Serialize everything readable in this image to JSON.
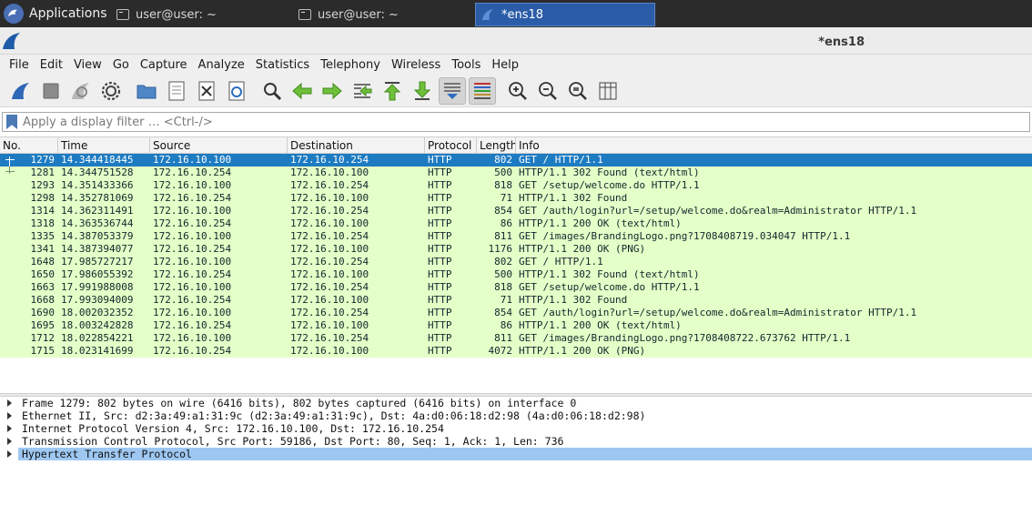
{
  "taskbar": {
    "apps_label": "Applications",
    "tasks": [
      {
        "label": "user@user: ~"
      },
      {
        "label": "user@user: ~"
      },
      {
        "label": "*ens18"
      }
    ]
  },
  "window": {
    "title": "*ens18"
  },
  "menu": [
    "File",
    "Edit",
    "View",
    "Go",
    "Capture",
    "Analyze",
    "Statistics",
    "Telephony",
    "Wireless",
    "Tools",
    "Help"
  ],
  "filter": {
    "placeholder": "Apply a display filter … <Ctrl-/>",
    "value": ""
  },
  "columns": {
    "no": "No.",
    "time": "Time",
    "source": "Source",
    "destination": "Destination",
    "protocol": "Protocol",
    "length": "Length",
    "info": "Info"
  },
  "packets": [
    {
      "no": "1279",
      "time": "14.344418445",
      "src": "172.16.10.100",
      "dst": "172.16.10.254",
      "proto": "HTTP",
      "len": "802",
      "info": "GET / HTTP/1.1"
    },
    {
      "no": "1281",
      "time": "14.344751528",
      "src": "172.16.10.254",
      "dst": "172.16.10.100",
      "proto": "HTTP",
      "len": "500",
      "info": "HTTP/1.1 302 Found  (text/html)"
    },
    {
      "no": "1293",
      "time": "14.351433366",
      "src": "172.16.10.100",
      "dst": "172.16.10.254",
      "proto": "HTTP",
      "len": "818",
      "info": "GET /setup/welcome.do HTTP/1.1"
    },
    {
      "no": "1298",
      "time": "14.352781069",
      "src": "172.16.10.254",
      "dst": "172.16.10.100",
      "proto": "HTTP",
      "len": "71",
      "info": "HTTP/1.1 302 Found"
    },
    {
      "no": "1314",
      "time": "14.362311491",
      "src": "172.16.10.100",
      "dst": "172.16.10.254",
      "proto": "HTTP",
      "len": "854",
      "info": "GET /auth/login?url=/setup/welcome.do&realm=Administrator HTTP/1.1"
    },
    {
      "no": "1318",
      "time": "14.363536744",
      "src": "172.16.10.254",
      "dst": "172.16.10.100",
      "proto": "HTTP",
      "len": "86",
      "info": "HTTP/1.1 200 OK  (text/html)"
    },
    {
      "no": "1335",
      "time": "14.387053379",
      "src": "172.16.10.100",
      "dst": "172.16.10.254",
      "proto": "HTTP",
      "len": "811",
      "info": "GET /images/BrandingLogo.png?1708408719.034047 HTTP/1.1"
    },
    {
      "no": "1341",
      "time": "14.387394077",
      "src": "172.16.10.254",
      "dst": "172.16.10.100",
      "proto": "HTTP",
      "len": "1176",
      "info": "HTTP/1.1 200 OK  (PNG)"
    },
    {
      "no": "1648",
      "time": "17.985727217",
      "src": "172.16.10.100",
      "dst": "172.16.10.254",
      "proto": "HTTP",
      "len": "802",
      "info": "GET / HTTP/1.1"
    },
    {
      "no": "1650",
      "time": "17.986055392",
      "src": "172.16.10.254",
      "dst": "172.16.10.100",
      "proto": "HTTP",
      "len": "500",
      "info": "HTTP/1.1 302 Found  (text/html)"
    },
    {
      "no": "1663",
      "time": "17.991988008",
      "src": "172.16.10.100",
      "dst": "172.16.10.254",
      "proto": "HTTP",
      "len": "818",
      "info": "GET /setup/welcome.do HTTP/1.1"
    },
    {
      "no": "1668",
      "time": "17.993094009",
      "src": "172.16.10.254",
      "dst": "172.16.10.100",
      "proto": "HTTP",
      "len": "71",
      "info": "HTTP/1.1 302 Found"
    },
    {
      "no": "1690",
      "time": "18.002032352",
      "src": "172.16.10.100",
      "dst": "172.16.10.254",
      "proto": "HTTP",
      "len": "854",
      "info": "GET /auth/login?url=/setup/welcome.do&realm=Administrator HTTP/1.1"
    },
    {
      "no": "1695",
      "time": "18.003242828",
      "src": "172.16.10.254",
      "dst": "172.16.10.100",
      "proto": "HTTP",
      "len": "86",
      "info": "HTTP/1.1 200 OK  (text/html)"
    },
    {
      "no": "1712",
      "time": "18.022854221",
      "src": "172.16.10.100",
      "dst": "172.16.10.254",
      "proto": "HTTP",
      "len": "811",
      "info": "GET /images/BrandingLogo.png?1708408722.673762 HTTP/1.1"
    },
    {
      "no": "1715",
      "time": "18.023141699",
      "src": "172.16.10.254",
      "dst": "172.16.10.100",
      "proto": "HTTP",
      "len": "4072",
      "info": "HTTP/1.1 200 OK  (PNG)"
    }
  ],
  "details": [
    "Frame 1279: 802 bytes on wire (6416 bits), 802 bytes captured (6416 bits) on interface 0",
    "Ethernet II, Src: d2:3a:49:a1:31:9c (d2:3a:49:a1:31:9c), Dst: 4a:d0:06:18:d2:98 (4a:d0:06:18:d2:98)",
    "Internet Protocol Version 4, Src: 172.16.10.100, Dst: 172.16.10.254",
    "Transmission Control Protocol, Src Port: 59186, Dst Port: 80, Seq: 1, Ack: 1, Len: 736",
    "Hypertext Transfer Protocol"
  ],
  "colors": {
    "row_bg": "#e4ffc7",
    "selected_row": "#1d7bc2",
    "selected_detail": "#9ec8f2",
    "taskbar": "#2b2b2b"
  }
}
